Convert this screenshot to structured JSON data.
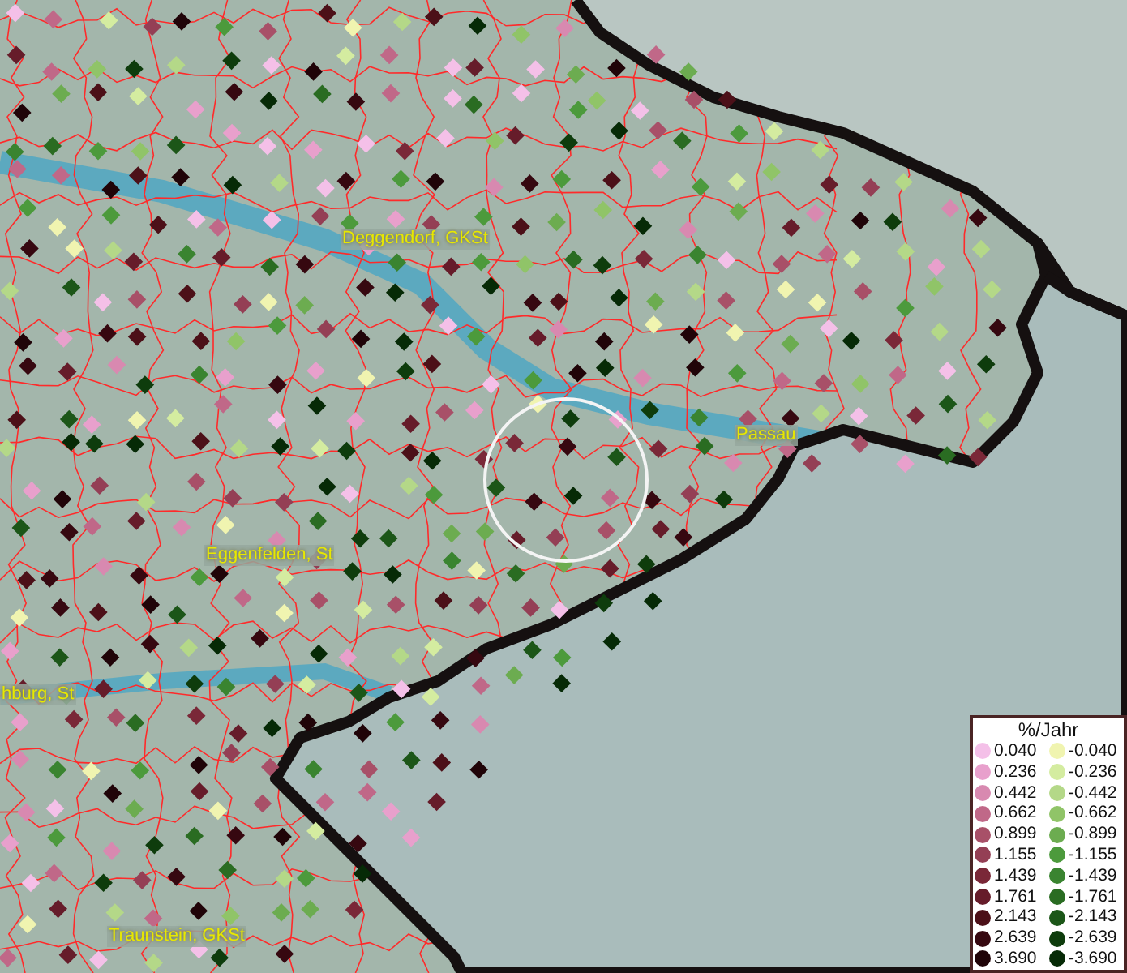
{
  "map": {
    "places": [
      {
        "name": "Deggendorf, GKSt"
      },
      {
        "name": "Passau"
      },
      {
        "name": "Eggenfelden, St"
      },
      {
        "name": "hburg, St"
      },
      {
        "name": "Traunstein, GKSt"
      }
    ]
  },
  "legend": {
    "title": "%/Jahr",
    "rows": [
      {
        "positive": {
          "label": "0.040",
          "color": "#f4c0e8"
        },
        "negative": {
          "label": "-0.040",
          "color": "#f0f4b0"
        }
      },
      {
        "positive": {
          "label": "0.236",
          "color": "#e8a0cc"
        },
        "negative": {
          "label": "-0.236",
          "color": "#d4eca0"
        }
      },
      {
        "positive": {
          "label": "0.442",
          "color": "#d889b0"
        },
        "negative": {
          "label": "-0.442",
          "color": "#b4d888"
        }
      },
      {
        "positive": {
          "label": "0.662",
          "color": "#c06888"
        },
        "negative": {
          "label": "-0.662",
          "color": "#90c468"
        }
      },
      {
        "positive": {
          "label": "0.899",
          "color": "#a85068"
        },
        "negative": {
          "label": "-0.899",
          "color": "#6cac50"
        }
      },
      {
        "positive": {
          "label": "1.155",
          "color": "#943f55"
        },
        "negative": {
          "label": "-1.155",
          "color": "#4c9a3c"
        }
      },
      {
        "positive": {
          "label": "1.439",
          "color": "#7a2838"
        },
        "negative": {
          "label": "-1.439",
          "color": "#3a8430"
        }
      },
      {
        "positive": {
          "label": "1.761",
          "color": "#661c2a"
        },
        "negative": {
          "label": "-1.761",
          "color": "#2a6c22"
        }
      },
      {
        "positive": {
          "label": "2.143",
          "color": "#4c1018"
        },
        "negative": {
          "label": "-2.143",
          "color": "#1c5618"
        }
      },
      {
        "positive": {
          "label": "2.639",
          "color": "#360810"
        },
        "negative": {
          "label": "-2.639",
          "color": "#0e3c0c"
        }
      },
      {
        "positive": {
          "label": "3.690",
          "color": "#200408"
        },
        "negative": {
          "label": "-3.690",
          "color": "#062a06"
        }
      }
    ]
  }
}
